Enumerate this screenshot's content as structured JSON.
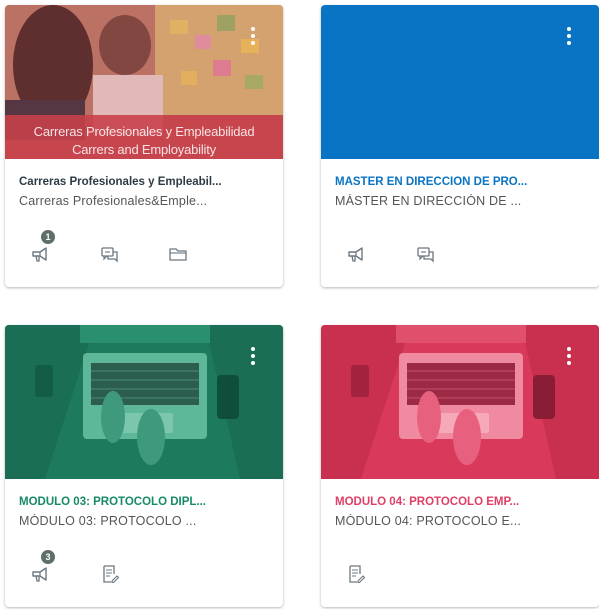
{
  "colors": {
    "card1_hero": "#c8404a",
    "card2_hero": "#0a74c4",
    "card3_hero": "#178a67",
    "card4_hero": "#e03e64",
    "card1_title": "#2d3b45",
    "card2_title": "#0a74c4",
    "card3_title": "#178a67",
    "card4_title": "#e03e64",
    "icon": "#6b7780",
    "badge": "#5d6f69"
  },
  "cards": [
    {
      "overlay_line1": "Carreras Profesionales y Empleabilidad",
      "overlay_line2": "Carrers and Employability",
      "title": "Carreras Profesionales y Empleabil...",
      "subtitle": "Carreras Profesionales&Emple...",
      "announcements_badge": "1",
      "actions": [
        "announcements-icon",
        "discussions-icon",
        "files-icon"
      ]
    },
    {
      "title": "MÁSTER EN DIRECCIÓN DE PRO...",
      "subtitle": "MÁSTER EN DIRECCIÓN DE ...",
      "actions": [
        "announcements-icon",
        "discussions-icon"
      ]
    },
    {
      "title": "MÓDULO 03: PROTOCOLO DIPL...",
      "subtitle": "MÓDULO 03: PROTOCOLO ...",
      "announcements_badge": "3",
      "actions": [
        "announcements-icon",
        "assignments-icon"
      ]
    },
    {
      "title": "MÓDULO 04: PROTOCOLO EMP...",
      "subtitle": "MÓDULO 04: PROTOCOLO E...",
      "actions": [
        "assignments-icon"
      ]
    }
  ]
}
